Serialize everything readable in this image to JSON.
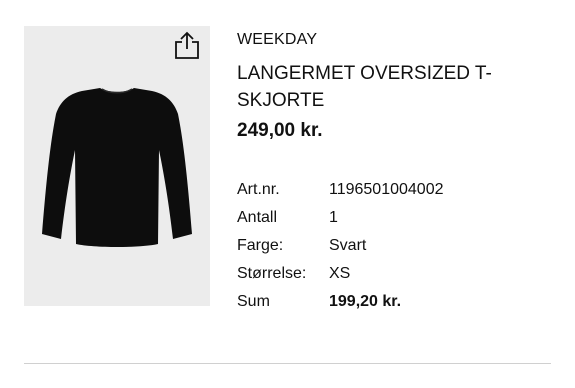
{
  "product": {
    "brand": "WEEKDAY",
    "title": "LANGERMET OVERSIZED T-SKJORTE",
    "price": "249,00 kr.",
    "image_icon": "black-long-sleeve-tshirt",
    "share_icon": "share-icon"
  },
  "details": [
    {
      "label": "Art.nr.",
      "value": "1196501004002"
    },
    {
      "label": "Antall",
      "value": "1"
    },
    {
      "label": "Farge:",
      "value": "Svart"
    },
    {
      "label": "Størrelse:",
      "value": "XS"
    },
    {
      "label": "Sum",
      "value": "199,20 kr."
    }
  ],
  "colors": {
    "image_background": "#ececec",
    "garment": "#0d0d0d",
    "divider": "#d0d0d0"
  }
}
